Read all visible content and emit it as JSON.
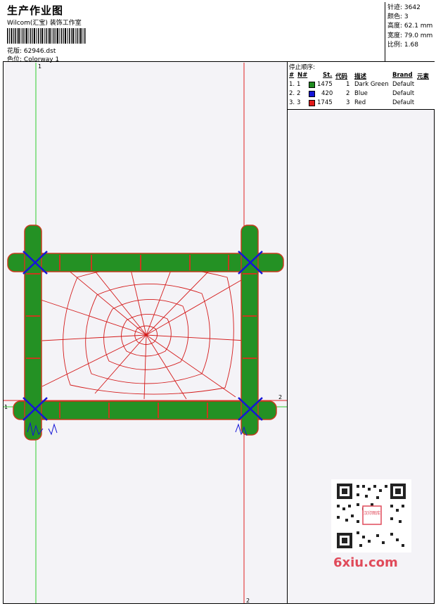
{
  "header": {
    "title": "生产作业图",
    "company": "Wilcom(汇宝) 装饰工作室",
    "file_label": "花版:",
    "file_value": "62946.dst",
    "colorway_label": "色位:",
    "colorway_value": "Colorway 1"
  },
  "stats": {
    "stitches": "针迹: 3642",
    "colors": "颜色: 3",
    "height": "高度: 62.1 mm",
    "width": "宽度: 79.0 mm",
    "scale": "比例: 1.68"
  },
  "stop_sequence": {
    "title": "停止顺序:",
    "headers": [
      "#",
      "N#",
      "St.",
      "代码",
      "描述",
      "Brand",
      "元素"
    ],
    "rows": [
      {
        "idx": "1.",
        "n": "1",
        "color": "#1f8a1f",
        "stitches": "1475",
        "code": "1",
        "desc": "Dark Green",
        "brand": "Default"
      },
      {
        "idx": "2.",
        "n": "2",
        "color": "#1515d6",
        "stitches": "420",
        "code": "2",
        "desc": "Blue",
        "brand": "Default"
      },
      {
        "idx": "3.",
        "n": "3",
        "color": "#e01a1a",
        "stitches": "1745",
        "code": "3",
        "desc": "Red",
        "brand": "Default"
      }
    ]
  },
  "guides": {
    "v1": "1",
    "v2": "2",
    "h1": "1",
    "h2": "2"
  },
  "watermark": "6xiu.com",
  "qr_badge": "汉印图库"
}
